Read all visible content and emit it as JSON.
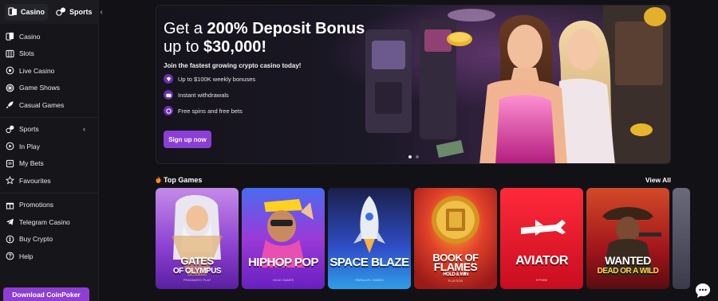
{
  "sidebar": {
    "top_tabs": [
      {
        "label": "Casino",
        "icon": "casino-cards-icon"
      },
      {
        "label": "Sports",
        "icon": "sports-ball-icon"
      }
    ],
    "groups": [
      [
        {
          "label": "Casino",
          "icon": "cards-icon"
        },
        {
          "label": "Slots",
          "icon": "slot-machine-icon"
        },
        {
          "label": "Live Casino",
          "icon": "roulette-icon"
        },
        {
          "label": "Game Shows",
          "icon": "wheel-icon"
        },
        {
          "label": "Casual Games",
          "icon": "rocket-icon"
        }
      ],
      [
        {
          "label": "Sports",
          "icon": "sports-ball-icon",
          "chevron": "‹"
        },
        {
          "label": "In Play",
          "icon": "play-circle-icon"
        },
        {
          "label": "My Bets",
          "icon": "ticket-icon"
        },
        {
          "label": "Favourites",
          "icon": "star-icon"
        }
      ],
      [
        {
          "label": "Promotions",
          "icon": "gift-icon"
        },
        {
          "label": "Telegram Casino",
          "icon": "telegram-icon"
        },
        {
          "label": "Buy Crypto",
          "icon": "coin-icon"
        },
        {
          "label": "Help",
          "icon": "help-icon"
        }
      ]
    ],
    "download_label": "Download CoinPoker"
  },
  "banner": {
    "headline_pre": "Get a ",
    "headline_bold": "200% Deposit Bonus",
    "headline_line2_pre": "up to ",
    "headline_line2_bold": "$30,000!",
    "subline": "Join the fastest growing crypto casino today!",
    "features": [
      {
        "text": "Up to $100K weekly bonuses",
        "icon": "gem-icon"
      },
      {
        "text": "Instant withdrawals",
        "icon": "wallet-icon"
      },
      {
        "text": "Free spins and free bets",
        "icon": "spin-icon"
      }
    ],
    "cta_label": "Sign up now",
    "slides": 2,
    "active_slide": 0
  },
  "games": {
    "title": "Top Games",
    "view_all": "View All",
    "items": [
      {
        "name1": "GATES",
        "name2": "OF OLYMPUS",
        "provider": "PRAGMATIC PLAY",
        "color": "#8a3fd0"
      },
      {
        "name1": "HIPHOP POP",
        "name2": "",
        "provider": "HOLE GAMES",
        "color": "#9a3ad8"
      },
      {
        "name1": "SPACE BLAZE",
        "name2": "",
        "provider": "PARALLEL GAMES",
        "color": "#2f6fe8"
      },
      {
        "name1": "BOOK OF",
        "name2": "FLAMES",
        "name3": "HOLD & WIN",
        "provider": "PLAYSON",
        "color": "#e0402a"
      },
      {
        "name1": "AVIATOR",
        "name2": "",
        "provider": "SPRIBE",
        "color": "#e5132a"
      },
      {
        "name1": "WANTED",
        "name2": "DEAD OR A WILD",
        "provider": "HACKSAW",
        "color": "#a3161b"
      }
    ]
  },
  "chat": {
    "icon": "chat-icon"
  }
}
